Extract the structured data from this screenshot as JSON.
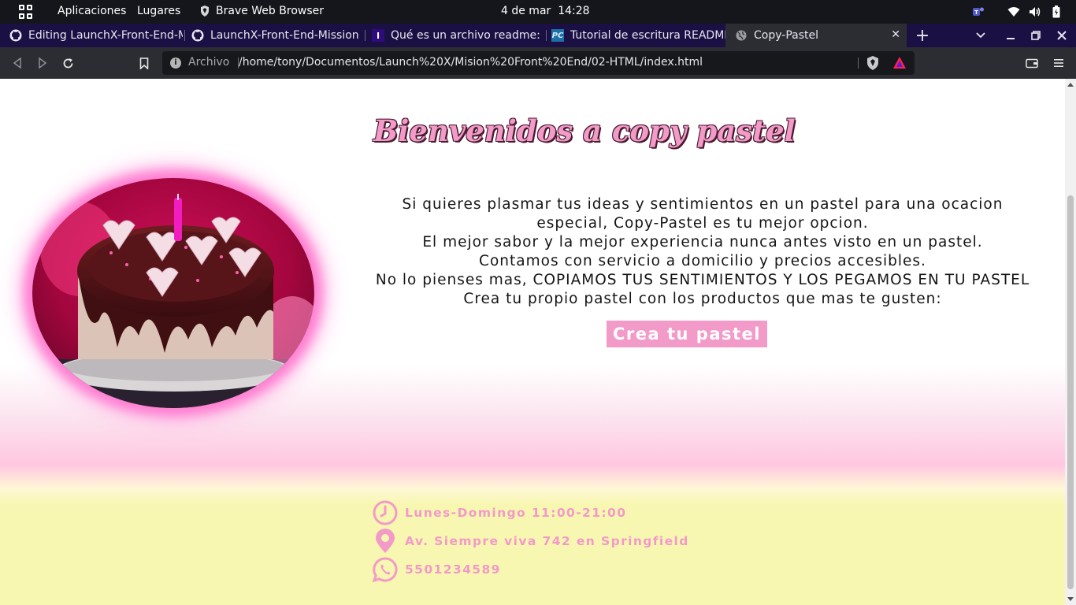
{
  "system_bar": {
    "activities": "Aplicaciones",
    "places": "Lugares",
    "app": "Brave Web Browser",
    "date": "4 de mar",
    "time": "14:28"
  },
  "tabs": [
    {
      "title": "Editing LaunchX-Front-End-Mission",
      "icon": "github-icon"
    },
    {
      "title": "LaunchX-Front-End-Mission",
      "icon": "github-icon"
    },
    {
      "title": "Qué es un archivo readme: ex",
      "icon": "i-favicon"
    },
    {
      "title": "Tutorial de escritura README",
      "icon": "pc-favicon"
    },
    {
      "title": "Copy-Pastel",
      "icon": "globe-icon",
      "active": true
    }
  ],
  "address_bar": {
    "scheme_label": "Archivo",
    "url": "/home/tony/Documentos/Launch%20X/Mision%20Front%20End/02-HTML/index.html"
  },
  "page": {
    "title": "Bienvenidos a copy pastel",
    "description_lines": [
      "Si quieres plasmar tus ideas y sentimientos en un pastel para una ocacion especial, Copy-Pastel es tu mejor opcion.",
      "El mejor sabor y la mejor experiencia nunca antes visto en un pastel.",
      "Contamos con servicio a domicilio y precios accesibles.",
      "No lo pienses mas, COPIAMOS TUS SENTIMIENTOS Y LOS PEGAMOS EN TU PASTEL",
      "Crea tu propio pastel con los productos que mas te gusten:"
    ],
    "cta_label": "Crea tu pastel",
    "info": {
      "hours": "Lunes-Domingo 11:00-21:00",
      "address": "Av. Siempre viva 742 en Springfield",
      "phone": "5501234589"
    }
  },
  "colors": {
    "accent_pink": "#f29ac8",
    "footer_yellow": "#f8f7b2",
    "tab_strip": "#1a1044",
    "toolbar": "#2b2d33"
  }
}
